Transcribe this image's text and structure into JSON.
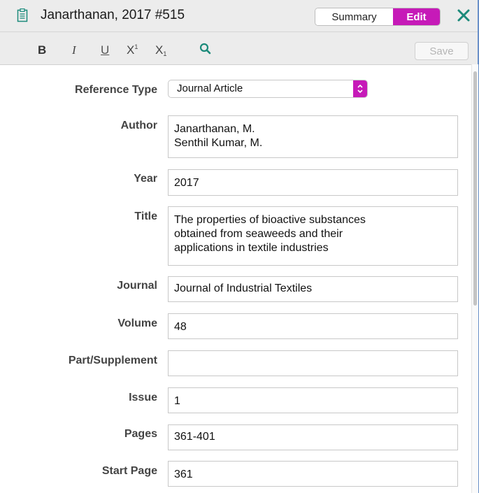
{
  "header": {
    "title": "Janarthanan, 2017 #515",
    "summary_label": "Summary",
    "edit_label": "Edit"
  },
  "toolbar": {
    "bold": "B",
    "italic": "I",
    "underline": "U",
    "superscript": "X",
    "superscript_mark": "1",
    "subscript": "X",
    "subscript_mark": "1",
    "save_label": "Save"
  },
  "form": {
    "reference_type_label": "Reference Type",
    "reference_type_value": "Journal Article",
    "fields": [
      {
        "label": "Author",
        "value": "Janarthanan, M.\nSenthil Kumar, M."
      },
      {
        "label": "Year",
        "value": "2017"
      },
      {
        "label": "Title",
        "value": "The properties of bioactive substances\nobtained from seaweeds and their\napplications in textile industries"
      },
      {
        "label": "Journal",
        "value": "Journal of Industrial Textiles"
      },
      {
        "label": "Volume",
        "value": "48"
      },
      {
        "label": "Part/Supplement",
        "value": ""
      },
      {
        "label": "Issue",
        "value": "1"
      },
      {
        "label": "Pages",
        "value": "361-401"
      },
      {
        "label": "Start Page",
        "value": "361"
      }
    ]
  },
  "colors": {
    "accent": "#c61ab8",
    "close": "#1b8a7a",
    "search": "#1b8a7a"
  }
}
